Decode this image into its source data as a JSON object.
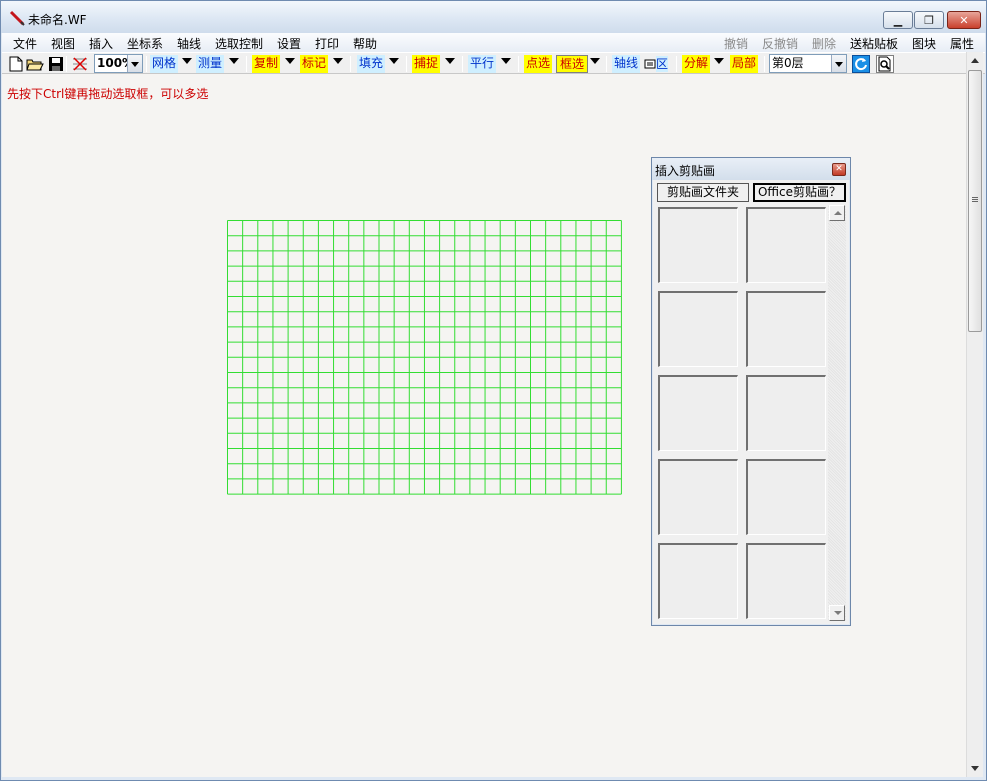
{
  "window": {
    "title": "未命名.WF"
  },
  "menubar": {
    "left": [
      "文件",
      "视图",
      "插入",
      "坐标系",
      "轴线",
      "选取控制",
      "设置",
      "打印",
      "帮助"
    ],
    "right": [
      {
        "label": "撤销",
        "enabled": false
      },
      {
        "label": "反撤销",
        "enabled": false
      },
      {
        "label": "删除",
        "enabled": false
      },
      {
        "label": "送粘贴板",
        "enabled": true
      },
      {
        "label": "图块",
        "enabled": true
      },
      {
        "label": "属性",
        "enabled": true
      }
    ]
  },
  "toolbar": {
    "zoom": "100%",
    "grid": "网格",
    "measure": "测量",
    "copy": "复制",
    "mark": "标记",
    "fill": "填充",
    "snap": "捕捉",
    "parallel": "平行",
    "point_select": "点选",
    "box_select": "框选",
    "axis": "轴线",
    "region": "区",
    "explode": "分解",
    "local": "局部",
    "layer": "第0层"
  },
  "canvas": {
    "hint": "先按下Ctrl键再拖动选取框，可以多选",
    "grid_color": "#33dd33",
    "background": "#f5f4f2"
  },
  "clip_panel": {
    "title": "插入剪贴画",
    "tab_folder": "剪贴画文件夹",
    "tab_office": "Office剪贴画？",
    "thumbnail_count": 10
  },
  "icons": {
    "app": "pencil-icon",
    "new": "new-file-icon",
    "open": "open-folder-icon",
    "save": "save-disk-icon",
    "snap_grid": "grid-snap-icon",
    "print_preview": "print-preview-icon",
    "refresh": "refresh-icon"
  }
}
